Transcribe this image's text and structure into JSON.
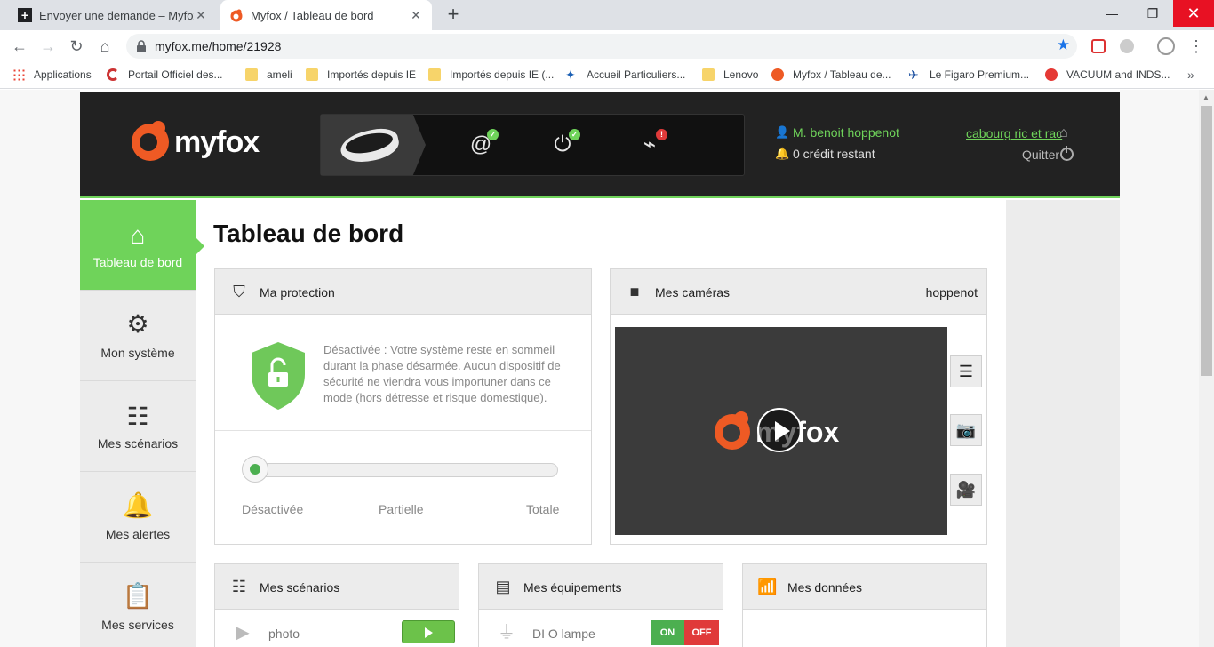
{
  "browser": {
    "tabs": [
      {
        "title": "Envoyer une demande – Myfox",
        "active": false
      },
      {
        "title": "Myfox / Tableau de bord",
        "active": true
      }
    ],
    "url": "myfox.me/home/21928",
    "bookmarks": [
      {
        "label": "Applications",
        "icon": "apps-grid-icon"
      },
      {
        "label": "Portail Officiel des...",
        "icon": "site-icon"
      },
      {
        "label": "ameli",
        "icon": "folder-icon"
      },
      {
        "label": "Importés depuis IE",
        "icon": "folder-icon"
      },
      {
        "label": "Importés depuis IE (...",
        "icon": "folder-icon"
      },
      {
        "label": "Accueil Particuliers...",
        "icon": "site-icon"
      },
      {
        "label": "Lenovo",
        "icon": "folder-icon"
      },
      {
        "label": "Myfox / Tableau de...",
        "icon": "myfox-icon"
      },
      {
        "label": "Le Figaro Premium...",
        "icon": "site-icon"
      },
      {
        "label": "VACUUM and INDS...",
        "icon": "site-icon"
      }
    ]
  },
  "header": {
    "logo_text": "myfox",
    "user_name": "M. benoit hoppenot",
    "credit": "0 crédit restant",
    "site_name": "cabourg ric et rac",
    "quit": "Quitter",
    "status_icons": [
      {
        "name": "network-icon",
        "state": "ok"
      },
      {
        "name": "power-icon",
        "state": "ok"
      },
      {
        "name": "alarm-monitor-icon",
        "state": "error"
      }
    ]
  },
  "sidebar": {
    "items": [
      {
        "label": "Tableau de bord",
        "icon": "home-icon",
        "active": true
      },
      {
        "label": "Mon système",
        "icon": "gears-icon",
        "active": false
      },
      {
        "label": "Mes scénarios",
        "icon": "scenarios-icon",
        "active": false
      },
      {
        "label": "Mes alertes",
        "icon": "bell-icon",
        "active": false
      },
      {
        "label": "Mes services",
        "icon": "clipboard-icon",
        "active": false
      }
    ]
  },
  "main": {
    "title": "Tableau de bord",
    "protection": {
      "title": "Ma protection",
      "description": "Désactivée : Votre système reste en sommeil durant la phase désarmée. Aucun dispositif de sécurité ne viendra vous importuner dans ce mode (hors détresse et risque domestique).",
      "levels": [
        "Désactivée",
        "Partielle",
        "Totale"
      ],
      "current_level": "Désactivée"
    },
    "cameras": {
      "title": "Mes caméras",
      "camera_name": "hoppenot",
      "video_logo": "myfox"
    },
    "scenarios": {
      "title": "Mes scénarios",
      "rows": [
        {
          "label": "photo"
        }
      ]
    },
    "equipment": {
      "title": "Mes équipements",
      "rows": [
        {
          "label": "DI O lampe",
          "on_label": "ON",
          "off_label": "OFF"
        }
      ]
    },
    "data": {
      "title": "Mes données"
    }
  },
  "colors": {
    "accent_green": "#6fd35a",
    "header_bg": "#222222",
    "brand_orange": "#ee5a24"
  }
}
